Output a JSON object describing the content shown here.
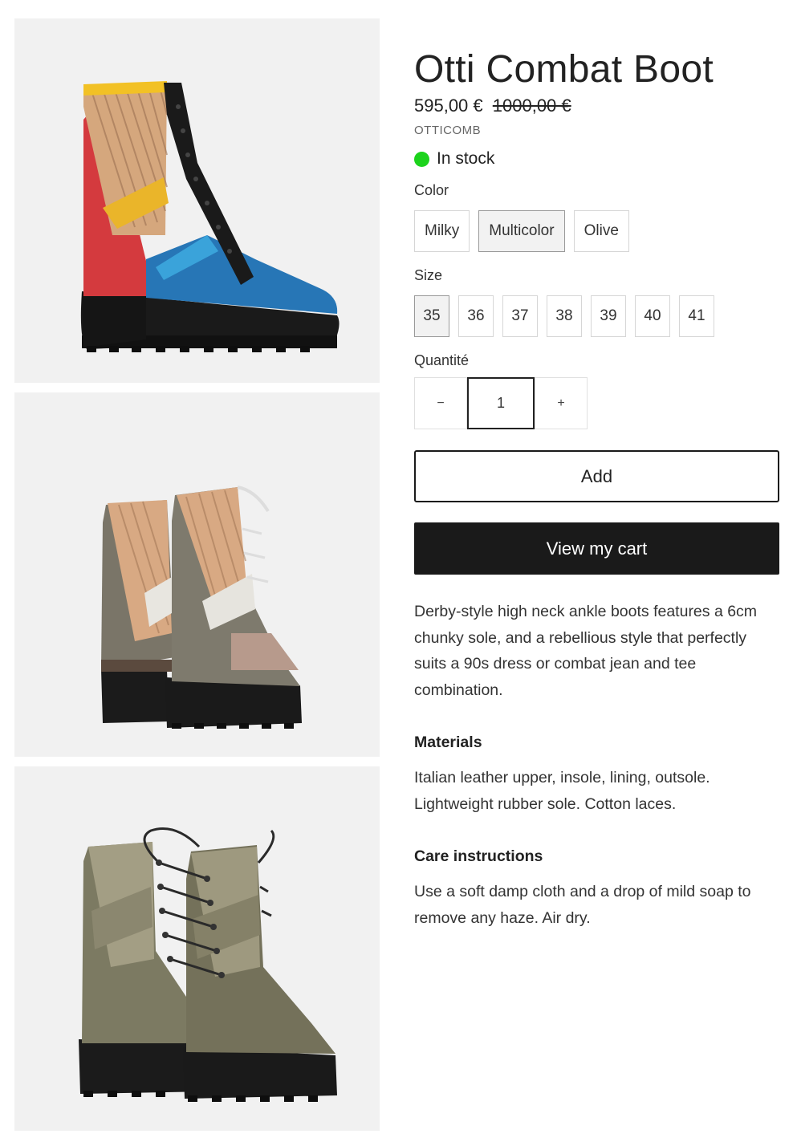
{
  "product": {
    "title": "Otti Combat Boot",
    "price": "595,00 €",
    "compare_price": "1000,00 €",
    "sku": "OTTICOMB",
    "stock_status": "In stock",
    "stock_color": "#1cd31c"
  },
  "color_option": {
    "label": "Color",
    "values": [
      "Milky",
      "Multicolor",
      "Olive"
    ],
    "selected": "Multicolor"
  },
  "size_option": {
    "label": "Size",
    "values": [
      "35",
      "36",
      "37",
      "38",
      "39",
      "40",
      "41"
    ],
    "selected": "35"
  },
  "quantity": {
    "label": "Quantité",
    "value": "1",
    "minus": "−",
    "plus": "+"
  },
  "buttons": {
    "add": "Add",
    "view_cart": "View my cart"
  },
  "description": "Derby-style high neck ankle boots features a 6cm chunky sole, and a rebellious style that perfectly suits a 90s dress or combat jean and tee combination.",
  "materials": {
    "title": "Materials",
    "body": "Italian leather upper, insole, lining, outsole. Lightweight rubber sole. Cotton laces."
  },
  "care": {
    "title": "Care instructions",
    "body": "Use a soft damp cloth and a drop of mild soap to remove any haze. Air dry."
  },
  "gallery": [
    {
      "alt": "multicolor-boot-side-view"
    },
    {
      "alt": "multicolor-boots-back-view"
    },
    {
      "alt": "olive-boots-front-view"
    }
  ]
}
